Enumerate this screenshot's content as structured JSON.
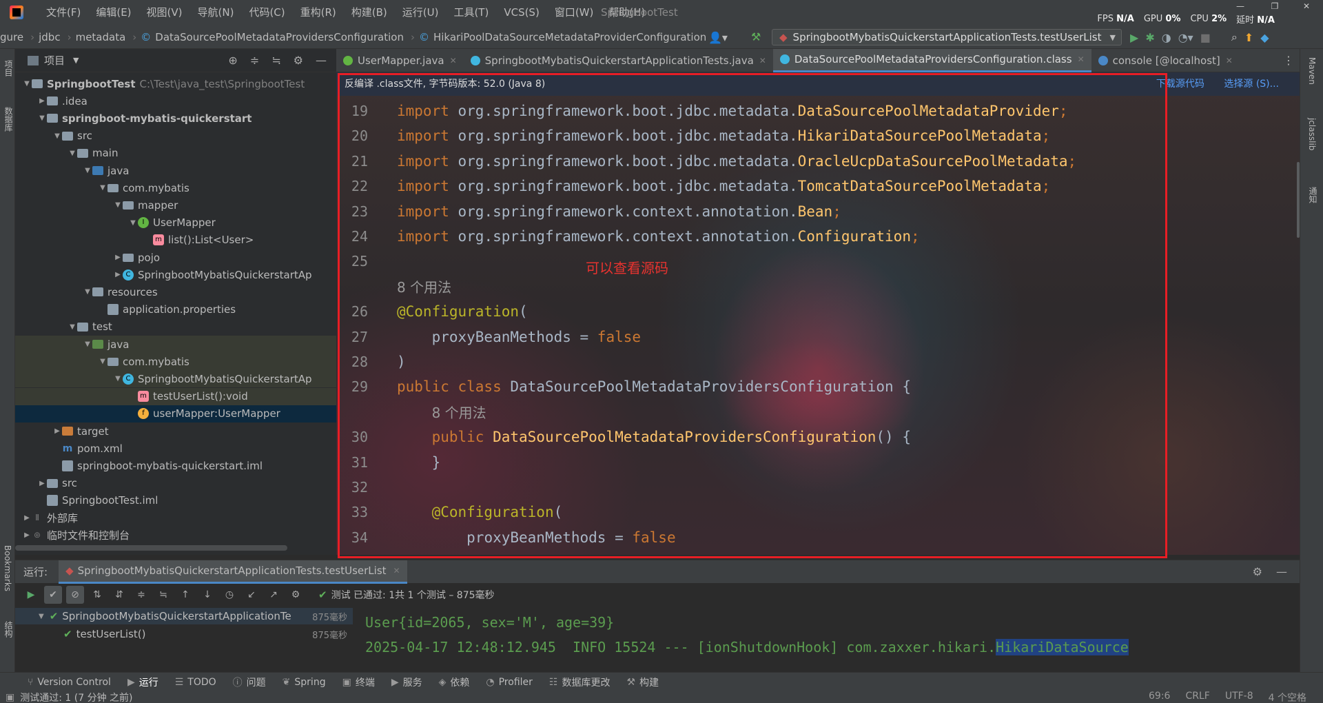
{
  "menubar": {
    "items": [
      "文件(F)",
      "编辑(E)",
      "视图(V)",
      "导航(N)",
      "代码(C)",
      "重构(R)",
      "构建(B)",
      "运行(U)",
      "工具(T)",
      "VCS(S)",
      "窗口(W)",
      "帮助(H)"
    ],
    "title": "SpringbootTest",
    "fps_label": "FPS",
    "fps_value": "N/A",
    "gpu_label": "GPU",
    "gpu_value": "0%",
    "cpu_label": "CPU",
    "cpu_value": "2%",
    "delay_label": "延时",
    "delay_value": "N/A"
  },
  "navbar": {
    "crumbs": [
      "gure",
      "jdbc",
      "metadata",
      "DataSourcePoolMetadataProvidersConfiguration",
      "HikariPoolDataSourceMetadataProviderConfiguration"
    ],
    "run_config": "SpringbootMybatisQuickerstartApplicationTests.testUserList"
  },
  "leftstrip": {
    "project": "项目",
    "database": "数据库",
    "bookmarks": "Bookmarks",
    "structure": "结构"
  },
  "rightstrip": {
    "maven": "Maven",
    "jclasslib": "jclasslib",
    "notify": "通知"
  },
  "project": {
    "title": "项目",
    "tree": [
      {
        "label": "SpringbootTest",
        "extra": "C:\\Test\\java_test\\SpringbootTest",
        "bold": true
      },
      {
        "label": ".idea"
      },
      {
        "label": "springboot-mybatis-quickerstart",
        "bold": true
      },
      {
        "label": "src"
      },
      {
        "label": "main"
      },
      {
        "label": "java"
      },
      {
        "label": "com.mybatis"
      },
      {
        "label": "mapper"
      },
      {
        "label": "UserMapper"
      },
      {
        "label": "list():List<User>"
      },
      {
        "label": "pojo"
      },
      {
        "label": "SpringbootMybatisQuickerstartAp"
      },
      {
        "label": "resources"
      },
      {
        "label": "application.properties"
      },
      {
        "label": "test"
      },
      {
        "label": "java"
      },
      {
        "label": "com.mybatis"
      },
      {
        "label": "SpringbootMybatisQuickerstartAp"
      },
      {
        "label": "testUserList():void"
      },
      {
        "label": "userMapper:UserMapper"
      },
      {
        "label": "target"
      },
      {
        "label": "pom.xml"
      },
      {
        "label": "springboot-mybatis-quickerstart.iml"
      },
      {
        "label": "src"
      },
      {
        "label": "SpringbootTest.iml"
      },
      {
        "label": "外部库"
      },
      {
        "label": "临时文件和控制台"
      }
    ]
  },
  "tabs": [
    {
      "label": "UserMapper.java"
    },
    {
      "label": "SpringbootMybatisQuickerstartApplicationTests.java"
    },
    {
      "label": "DataSourcePoolMetadataProvidersConfiguration.class"
    },
    {
      "label": "console [@localhost]"
    }
  ],
  "editor": {
    "decompile_notice": "反编译 .class文件, 字节码版本: 52.0 (Java 8)",
    "download_sources": "下载源代码",
    "choose_sources": "选择源 (S)...",
    "note": "可以查看源码",
    "lines": [
      {
        "n": "19",
        "kind": "import",
        "pkg": "org.springframework.boot.jdbc.metadata.",
        "name": "DataSourcePoolMetadataProvider",
        "end": ";"
      },
      {
        "n": "20",
        "kind": "import",
        "pkg": "org.springframework.boot.jdbc.metadata.",
        "name": "HikariDataSourcePoolMetadata",
        "end": ";"
      },
      {
        "n": "21",
        "kind": "import",
        "pkg": "org.springframework.boot.jdbc.metadata.",
        "name": "OracleUcpDataSourcePoolMetadata",
        "end": ";"
      },
      {
        "n": "22",
        "kind": "import",
        "pkg": "org.springframework.boot.jdbc.metadata.",
        "name": "TomcatDataSourcePoolMetadata",
        "end": ";"
      },
      {
        "n": "23",
        "kind": "import",
        "pkg": "org.springframework.context.annotation.",
        "name": "Bean",
        "end": ";"
      },
      {
        "n": "24",
        "kind": "import",
        "pkg": "org.springframework.context.annotation.",
        "name": "Configuration",
        "end": ";"
      },
      {
        "n": "25",
        "kind": "blank"
      },
      {
        "n": "",
        "kind": "usage",
        "text": "8 个用法"
      },
      {
        "n": "26",
        "kind": "annot",
        "text": "@Configuration",
        "rest": "("
      },
      {
        "n": "27",
        "kind": "prop",
        "indent": "    ",
        "name": "proxyBeanMethods = ",
        "value": "false"
      },
      {
        "n": "28",
        "kind": "plain",
        "text": ")"
      },
      {
        "n": "29",
        "kind": "classdecl",
        "kw": "public class ",
        "name": "DataSourcePoolMetadataProvidersConfiguration",
        "rest": " {"
      },
      {
        "n": "",
        "kind": "usage",
        "indent": "    ",
        "text": "8 个用法"
      },
      {
        "n": "30",
        "kind": "ctor",
        "indent": "    ",
        "kw": "public ",
        "name": "DataSourcePoolMetadataProvidersConfiguration",
        "rest": "() {"
      },
      {
        "n": "31",
        "kind": "plain",
        "text": "    }"
      },
      {
        "n": "32",
        "kind": "blank"
      },
      {
        "n": "33",
        "kind": "annot",
        "indent": "    ",
        "text": "@Configuration",
        "rest": "("
      },
      {
        "n": "34",
        "kind": "prop",
        "indent": "        ",
        "name": "proxyBeanMethods = ",
        "value": "false"
      }
    ]
  },
  "run": {
    "label": "运行:",
    "tab": "SpringbootMybatisQuickerstartApplicationTests.testUserList",
    "status": "测试 已通过: 1共 1 个测试 – 875毫秒",
    "tree": [
      {
        "label": "SpringbootMybatisQuickerstartApplicationTe",
        "time": "875毫秒"
      },
      {
        "label": "testUserList()",
        "time": "875毫秒"
      }
    ],
    "console": [
      "User{id=2065, sex='M', age=39}",
      "2025-04-17 12:48:12.945  INFO 15524 --- [ionShutdownHook] com.zaxxer.hikari."
    ],
    "console_selected": "HikariDataSource"
  },
  "bottom_tools": [
    {
      "label": "Version Control",
      "icon": "⑂"
    },
    {
      "label": "运行",
      "icon": "▶"
    },
    {
      "label": "TODO",
      "icon": "☰"
    },
    {
      "label": "问题",
      "icon": "ⓘ"
    },
    {
      "label": "Spring",
      "icon": "❦"
    },
    {
      "label": "终端",
      "icon": "▣"
    },
    {
      "label": "服务",
      "icon": "▶"
    },
    {
      "label": "依赖",
      "icon": "◈"
    },
    {
      "label": "Profiler",
      "icon": "◔"
    },
    {
      "label": "数据库更改",
      "icon": "☷"
    },
    {
      "label": "构建",
      "icon": "⚒"
    }
  ],
  "status": {
    "message": "测试通过: 1 (7 分钟 之前)",
    "position": "69:6",
    "line_sep": "CRLF",
    "encoding": "UTF-8",
    "indent": "4 个空格"
  }
}
